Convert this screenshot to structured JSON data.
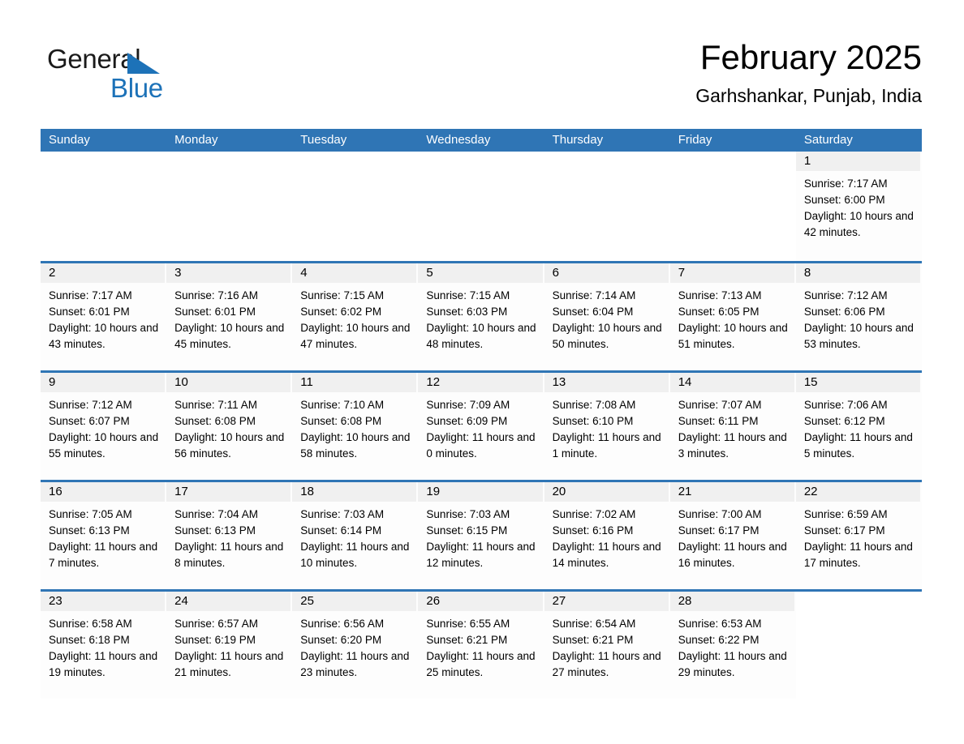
{
  "brand": {
    "word1": "General",
    "word2": "Blue",
    "accent_color": "#1d72b8"
  },
  "header": {
    "title": "February 2025",
    "location": "Garhshankar, Punjab, India"
  },
  "theme": {
    "header_bar_color": "#2f75b5",
    "date_band_color": "#f0f0f0",
    "separator_color": "#2f75b5"
  },
  "weekdays": [
    "Sunday",
    "Monday",
    "Tuesday",
    "Wednesday",
    "Thursday",
    "Friday",
    "Saturday"
  ],
  "weeks": [
    [
      {
        "day": "",
        "blank": true
      },
      {
        "day": "",
        "blank": true
      },
      {
        "day": "",
        "blank": true
      },
      {
        "day": "",
        "blank": true
      },
      {
        "day": "",
        "blank": true
      },
      {
        "day": "",
        "blank": true
      },
      {
        "day": "1",
        "sunrise": "Sunrise: 7:17 AM",
        "sunset": "Sunset: 6:00 PM",
        "daylight": "Daylight: 10 hours and 42 minutes."
      }
    ],
    [
      {
        "day": "2",
        "sunrise": "Sunrise: 7:17 AM",
        "sunset": "Sunset: 6:01 PM",
        "daylight": "Daylight: 10 hours and 43 minutes."
      },
      {
        "day": "3",
        "sunrise": "Sunrise: 7:16 AM",
        "sunset": "Sunset: 6:01 PM",
        "daylight": "Daylight: 10 hours and 45 minutes."
      },
      {
        "day": "4",
        "sunrise": "Sunrise: 7:15 AM",
        "sunset": "Sunset: 6:02 PM",
        "daylight": "Daylight: 10 hours and 47 minutes."
      },
      {
        "day": "5",
        "sunrise": "Sunrise: 7:15 AM",
        "sunset": "Sunset: 6:03 PM",
        "daylight": "Daylight: 10 hours and 48 minutes."
      },
      {
        "day": "6",
        "sunrise": "Sunrise: 7:14 AM",
        "sunset": "Sunset: 6:04 PM",
        "daylight": "Daylight: 10 hours and 50 minutes."
      },
      {
        "day": "7",
        "sunrise": "Sunrise: 7:13 AM",
        "sunset": "Sunset: 6:05 PM",
        "daylight": "Daylight: 10 hours and 51 minutes."
      },
      {
        "day": "8",
        "sunrise": "Sunrise: 7:12 AM",
        "sunset": "Sunset: 6:06 PM",
        "daylight": "Daylight: 10 hours and 53 minutes."
      }
    ],
    [
      {
        "day": "9",
        "sunrise": "Sunrise: 7:12 AM",
        "sunset": "Sunset: 6:07 PM",
        "daylight": "Daylight: 10 hours and 55 minutes."
      },
      {
        "day": "10",
        "sunrise": "Sunrise: 7:11 AM",
        "sunset": "Sunset: 6:08 PM",
        "daylight": "Daylight: 10 hours and 56 minutes."
      },
      {
        "day": "11",
        "sunrise": "Sunrise: 7:10 AM",
        "sunset": "Sunset: 6:08 PM",
        "daylight": "Daylight: 10 hours and 58 minutes."
      },
      {
        "day": "12",
        "sunrise": "Sunrise: 7:09 AM",
        "sunset": "Sunset: 6:09 PM",
        "daylight": "Daylight: 11 hours and 0 minutes."
      },
      {
        "day": "13",
        "sunrise": "Sunrise: 7:08 AM",
        "sunset": "Sunset: 6:10 PM",
        "daylight": "Daylight: 11 hours and 1 minute."
      },
      {
        "day": "14",
        "sunrise": "Sunrise: 7:07 AM",
        "sunset": "Sunset: 6:11 PM",
        "daylight": "Daylight: 11 hours and 3 minutes."
      },
      {
        "day": "15",
        "sunrise": "Sunrise: 7:06 AM",
        "sunset": "Sunset: 6:12 PM",
        "daylight": "Daylight: 11 hours and 5 minutes."
      }
    ],
    [
      {
        "day": "16",
        "sunrise": "Sunrise: 7:05 AM",
        "sunset": "Sunset: 6:13 PM",
        "daylight": "Daylight: 11 hours and 7 minutes."
      },
      {
        "day": "17",
        "sunrise": "Sunrise: 7:04 AM",
        "sunset": "Sunset: 6:13 PM",
        "daylight": "Daylight: 11 hours and 8 minutes."
      },
      {
        "day": "18",
        "sunrise": "Sunrise: 7:03 AM",
        "sunset": "Sunset: 6:14 PM",
        "daylight": "Daylight: 11 hours and 10 minutes."
      },
      {
        "day": "19",
        "sunrise": "Sunrise: 7:03 AM",
        "sunset": "Sunset: 6:15 PM",
        "daylight": "Daylight: 11 hours and 12 minutes."
      },
      {
        "day": "20",
        "sunrise": "Sunrise: 7:02 AM",
        "sunset": "Sunset: 6:16 PM",
        "daylight": "Daylight: 11 hours and 14 minutes."
      },
      {
        "day": "21",
        "sunrise": "Sunrise: 7:00 AM",
        "sunset": "Sunset: 6:17 PM",
        "daylight": "Daylight: 11 hours and 16 minutes."
      },
      {
        "day": "22",
        "sunrise": "Sunrise: 6:59 AM",
        "sunset": "Sunset: 6:17 PM",
        "daylight": "Daylight: 11 hours and 17 minutes."
      }
    ],
    [
      {
        "day": "23",
        "sunrise": "Sunrise: 6:58 AM",
        "sunset": "Sunset: 6:18 PM",
        "daylight": "Daylight: 11 hours and 19 minutes."
      },
      {
        "day": "24",
        "sunrise": "Sunrise: 6:57 AM",
        "sunset": "Sunset: 6:19 PM",
        "daylight": "Daylight: 11 hours and 21 minutes."
      },
      {
        "day": "25",
        "sunrise": "Sunrise: 6:56 AM",
        "sunset": "Sunset: 6:20 PM",
        "daylight": "Daylight: 11 hours and 23 minutes."
      },
      {
        "day": "26",
        "sunrise": "Sunrise: 6:55 AM",
        "sunset": "Sunset: 6:21 PM",
        "daylight": "Daylight: 11 hours and 25 minutes."
      },
      {
        "day": "27",
        "sunrise": "Sunrise: 6:54 AM",
        "sunset": "Sunset: 6:21 PM",
        "daylight": "Daylight: 11 hours and 27 minutes."
      },
      {
        "day": "28",
        "sunrise": "Sunrise: 6:53 AM",
        "sunset": "Sunset: 6:22 PM",
        "daylight": "Daylight: 11 hours and 29 minutes."
      },
      {
        "day": "",
        "blank": true
      }
    ]
  ]
}
